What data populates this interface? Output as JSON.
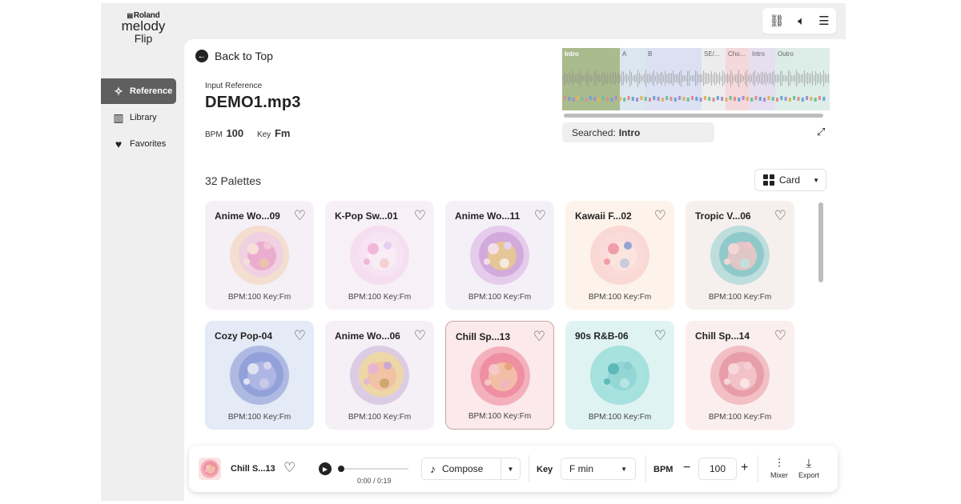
{
  "app": {
    "brand": "Roland",
    "name_line1": "melody",
    "name_line2": "Flip"
  },
  "sidebar": {
    "items": [
      {
        "label": "Reference",
        "icon": "sparkle-music-icon",
        "active": true
      },
      {
        "label": "Library",
        "icon": "library-icon",
        "active": false
      },
      {
        "label": "Favorites",
        "icon": "heart-icon",
        "active": false
      }
    ]
  },
  "topbar": {
    "buttons": [
      "link-icon",
      "speaker-icon",
      "menu-icon"
    ]
  },
  "header": {
    "back_label": "Back to Top",
    "input_reference_label": "Input Reference",
    "file_name": "DEMO1.mp3",
    "bpm_label": "BPM",
    "bpm_value": "100",
    "key_label": "Key",
    "key_value": "Fm"
  },
  "waveform": {
    "sections": [
      {
        "label": "Intro",
        "color": "#9bb07a"
      },
      {
        "label": "A",
        "color": "#d7e4ee"
      },
      {
        "label": "B",
        "color": "#d8def2"
      },
      {
        "label": "SE/...",
        "color": "#ececec"
      },
      {
        "label": "Cho...",
        "color": "#f3d4d8"
      },
      {
        "label": "Intro",
        "color": "#e4dcef"
      },
      {
        "label": "Outro",
        "color": "#d9ece6"
      }
    ],
    "searched_label": "Searched:",
    "searched_value": "Intro"
  },
  "palettes": {
    "count_label": "32 Palettes",
    "view_label": "Card",
    "cards": [
      {
        "title": "Anime Wo...09",
        "info": "BPM:100 Key:Fm",
        "bg": "#f5f0f6",
        "rings": [
          "#f3dccb",
          "#efcfe2",
          "#e9a9cd"
        ],
        "dots": [
          "#f7e0d9",
          "#f3c7d5",
          "#eec3a8"
        ]
      },
      {
        "title": "K-Pop Sw...01",
        "info": "BPM:100 Key:Fm",
        "bg": "#f7f1f7",
        "rings": [
          "#f4dcee",
          "#f6e4f2",
          "#f8ecf5"
        ],
        "dots": [
          "#f0b4d6",
          "#e7ccf0",
          "#f5d0d0"
        ]
      },
      {
        "title": "Anime Wo...11",
        "info": "BPM:100 Key:Fm",
        "bg": "#f4f0f8",
        "rings": [
          "#e3c7ea",
          "#cfa6d9",
          "#e8c98f"
        ],
        "dots": [
          "#f3e0e8",
          "#e8d4f0",
          "#f6ece0"
        ]
      },
      {
        "title": "Kawaii F...02",
        "info": "BPM:100 Key:Fm",
        "bg": "#fdf3ea",
        "rings": [
          "#f9d6d2",
          "#f9dada",
          "#fbe4de"
        ],
        "dots": [
          "#ef9aa5",
          "#8ea0d6",
          "#c5c8dc"
        ]
      },
      {
        "title": "Tropic V...06",
        "info": "BPM:100 Key:Fm",
        "bg": "#f5f0ee",
        "rings": [
          "#b7dcd9",
          "#8bc6c8",
          "#e9c7c7"
        ],
        "dots": [
          "#f4d7d7",
          "#f0c4c8",
          "#bfe2df"
        ]
      },
      {
        "title": "Cozy Pop-04",
        "info": "BPM:100 Key:Fm",
        "bg": "#e4eaf6",
        "rings": [
          "#a9b5e0",
          "#8f9fd8",
          "#b1b8e3"
        ],
        "dots": [
          "#e3e6f4",
          "#dcd7ef",
          "#c8cbe8"
        ]
      },
      {
        "title": "Anime Wo...06",
        "info": "BPM:100 Key:Fm",
        "bg": "#f4f0f6",
        "rings": [
          "#d8c8e2",
          "#efd8a0",
          "#f1c1a4"
        ],
        "dots": [
          "#e6b4d2",
          "#c7a8d8",
          "#c9a66b"
        ]
      },
      {
        "title": "Chill Sp...13",
        "info": "BPM:100 Key:Fm",
        "bg": "#fbe9eb",
        "rings": [
          "#f3aab7",
          "#f08ca0",
          "#f3c3a6"
        ],
        "dots": [
          "#f6c9c9",
          "#e7a27c",
          "#f1b5c0"
        ],
        "selected": true
      },
      {
        "title": "90s R&B-06",
        "info": "BPM:100 Key:Fm",
        "bg": "#dff3f2",
        "rings": [
          "#9fdfdc",
          "#a8e2df",
          "#8fd6d4"
        ],
        "dots": [
          "#5bb7b5",
          "#87cdcb",
          "#b9e6e3"
        ]
      },
      {
        "title": "Chill Sp...14",
        "info": "BPM:100 Key:Fm",
        "bg": "#fbeeee",
        "rings": [
          "#f0b9bf",
          "#e79aa5",
          "#f2c7cc"
        ],
        "dots": [
          "#f7d9dc",
          "#f5cfd3",
          "#fbe6e8"
        ]
      }
    ]
  },
  "player": {
    "track_name": "Chill S...13",
    "time": "0:00 / 0:19",
    "progress": 0,
    "mode_label": "Compose",
    "key_label": "Key",
    "key_value": "F min",
    "bpm_label": "BPM",
    "bpm_value": "100",
    "mixer_label": "Mixer",
    "export_label": "Export"
  }
}
